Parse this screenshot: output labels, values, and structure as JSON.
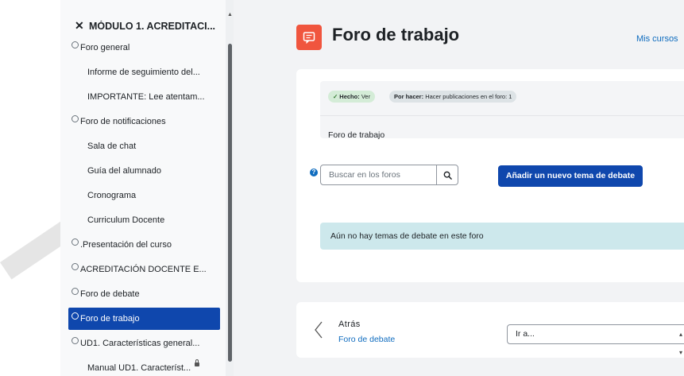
{
  "sidebar": {
    "section_title": "MÓDULO 1. ACREDITACI...",
    "items": [
      {
        "label": "Foro general",
        "marker": true,
        "active": false
      },
      {
        "label": "Informe de seguimiento del...",
        "marker": false,
        "active": false
      },
      {
        "label": "IMPORTANTE: Lee atentam...",
        "marker": false,
        "active": false
      },
      {
        "label": "Foro de notificaciones",
        "marker": true,
        "active": false
      },
      {
        "label": "Sala de chat",
        "marker": false,
        "active": false
      },
      {
        "label": "Guía del alumnado",
        "marker": false,
        "active": false
      },
      {
        "label": "Cronograma",
        "marker": false,
        "active": false
      },
      {
        "label": "Curriculum Docente",
        "marker": false,
        "active": false
      },
      {
        "label": ".Presentación del curso",
        "marker": true,
        "active": false
      },
      {
        "label": "ACREDITACIÓN DOCENTE E...",
        "marker": true,
        "active": false
      },
      {
        "label": "Foro de debate",
        "marker": true,
        "active": false
      },
      {
        "label": "Foro de trabajo",
        "marker": true,
        "active": true
      },
      {
        "label": "UD1. Características general...",
        "marker": true,
        "active": false
      },
      {
        "label": "Manual UD1. Característ...",
        "marker": false,
        "active": false,
        "locked": true
      }
    ]
  },
  "header": {
    "title": "Foro de trabajo",
    "mis_cursos": "Mis cursos"
  },
  "completion": {
    "done_label": "Hecho:",
    "done_value": "Ver",
    "todo_label": "Por hacer:",
    "todo_value": "Hacer publicaciones en el foro: 1"
  },
  "forum": {
    "description": "Foro de trabajo",
    "search_placeholder": "Buscar en los foros",
    "add_button": "Añadir un nuevo tema de debate",
    "empty_message": "Aún no hay temas de debate en este foro"
  },
  "nav": {
    "back_label": "Atrás",
    "back_link": "Foro de debate",
    "jump_label": "Ir a..."
  },
  "colors": {
    "primary": "#0f47ad",
    "link": "#0f6cbf",
    "forum_icon": "#f0553e",
    "alert_bg": "#cde8ec"
  }
}
